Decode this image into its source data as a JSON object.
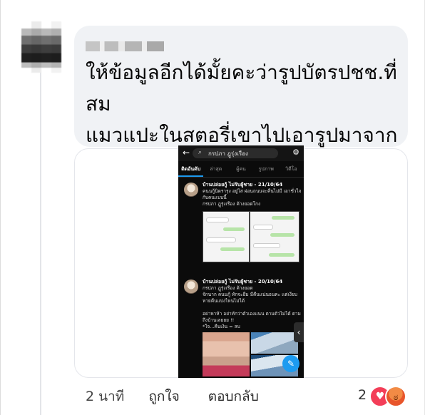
{
  "comment": {
    "author_name_blurred": "",
    "text": "ให้ข้อมูลอีกได้มั้ยคะว่ารูปบัตรปชช.ที่สม\nแมวแปะในสตอรี่เขาไปเอารูปมาจากทวิต\nสรุปปลอมหมดทุกอย่างเลย",
    "time": "2 นาที",
    "like_label": "ถูกใจ",
    "reply_label": "ตอบกลับ",
    "reaction_count": "2",
    "reactions": [
      "heart-icon",
      "angry-icon"
    ]
  },
  "screenshot": {
    "search_text": "กรปภา ฎูรุ่งเรือง",
    "tabs": [
      "ติดอันดับ",
      "ล่าสุด",
      "ผู้คน",
      "รูปภาพ",
      "วิดีโอ"
    ],
    "tweets": [
      {
        "name": "บ้านปล่อยกู้ ไม่รับผู้ชาย - 21/10/64",
        "body": "คนนกู้นิดรารุง อยู่ไส ผ่อนถนนจะคืนไม่มี เอาชั่วไจ\nกับคนแบบนี้\nกรปภา ฎูรุ่งเรือง  ค้างยอดโกง"
      },
      {
        "name": "บ้านปล่อยกู้ ไม่รับผู้ชาย - 20/10/64",
        "body": "กรปภา ฎูรุ่งเรือง  ค้างยอด\nจักนาก คนนกู้ ทักจะยืม มีคืนแน่นอนคะ แต่เงียบ\nหายคืนแบ่งไหนไม่ได้\n\nอย่าหาห้า อย่าทักว่าตัวเองแนน ตามตัวไม่ได้ ตาม\nถึงบ้านเลยยย !!\n*ใจ...คืนเงิน = ลบ"
      }
    ]
  },
  "colors": {
    "bubble_bg": "#f0f2f5",
    "heart": "#f33e58",
    "twitter_blue": "#1d9bf0"
  }
}
